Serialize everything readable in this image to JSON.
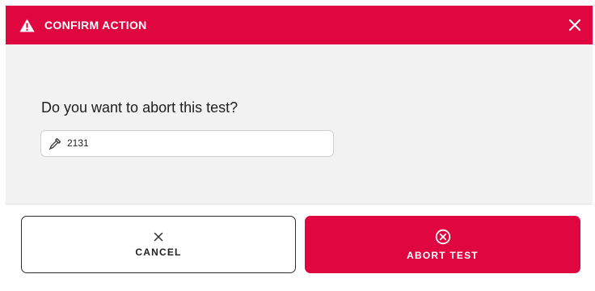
{
  "dialog": {
    "title": "CONFIRM ACTION",
    "accent_color": "#e0063f",
    "icons": {
      "header": "warning-triangle-icon",
      "close": "close-icon",
      "field": "pipette-icon",
      "cancel": "x-icon",
      "abort": "circle-x-icon"
    }
  },
  "body": {
    "question": "Do you want to abort this test?",
    "field_value": "2131"
  },
  "actions": {
    "cancel_label": "CANCEL",
    "abort_label": "ABORT TEST"
  }
}
